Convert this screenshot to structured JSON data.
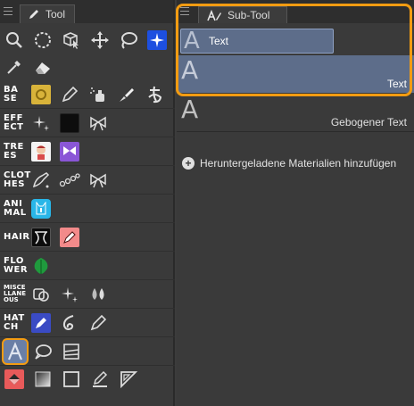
{
  "tool_panel": {
    "tab_label": "Tool",
    "groups": [
      {
        "lines": [
          "BA",
          "SE"
        ]
      },
      {
        "lines": [
          "EFF",
          "ECT"
        ]
      },
      {
        "lines": [
          "TRE",
          "ES"
        ]
      },
      {
        "lines": [
          "CLOT",
          "HES"
        ]
      },
      {
        "lines": [
          "ANI",
          "MAL"
        ]
      },
      {
        "lines": [
          "HAIR"
        ]
      },
      {
        "lines": [
          "FLO",
          "WER"
        ]
      },
      {
        "lines": [
          "MISCE",
          "LLANE",
          "OUS"
        ]
      },
      {
        "lines": [
          "HAT",
          "CH"
        ]
      }
    ]
  },
  "sub_tool_panel": {
    "tab_label": "Sub-Tool",
    "items": [
      {
        "label": "Text",
        "glyph": "A"
      },
      {
        "label": "Text",
        "glyph": "A"
      },
      {
        "label": "Gebogener Text",
        "glyph": "A"
      }
    ],
    "add_materials_label": "Heruntergeladene Materialien hinzufügen"
  },
  "colors": {
    "highlight_orange": "#f39c12",
    "selection_blue": "#5d6d8a",
    "panel_bg": "#3a3a3a"
  }
}
